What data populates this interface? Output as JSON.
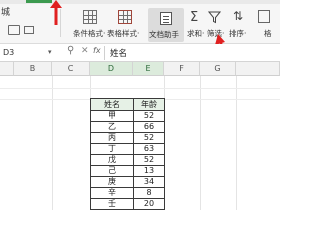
{
  "ribbon": {
    "left_text": "城",
    "conditional_format_label": "条件格式·",
    "table_style_label": "表格样式·",
    "doc_assistant_label": "文档助手",
    "sum_label": "求和·",
    "filter_label": "筛选·",
    "sort_label": "排序·",
    "format_label": "格"
  },
  "formula_bar": {
    "cell_ref": "D3",
    "content": "姓名"
  },
  "columns": [
    "B",
    "C",
    "D",
    "E",
    "F",
    "G"
  ],
  "selected_columns": [
    "D",
    "E"
  ],
  "table": {
    "headers": [
      "姓名",
      "年龄"
    ],
    "rows": [
      [
        "甲",
        "52"
      ],
      [
        "乙",
        "66"
      ],
      [
        "丙",
        "52"
      ],
      [
        "丁",
        "63"
      ],
      [
        "戊",
        "52"
      ],
      [
        "己",
        "13"
      ],
      [
        "庚",
        "34"
      ],
      [
        "辛",
        "8"
      ],
      [
        "壬",
        "20"
      ]
    ]
  },
  "colors": {
    "arrow": "#e02020",
    "header_fill": "#e6f1e6",
    "selected_column": "#dcebdc"
  }
}
